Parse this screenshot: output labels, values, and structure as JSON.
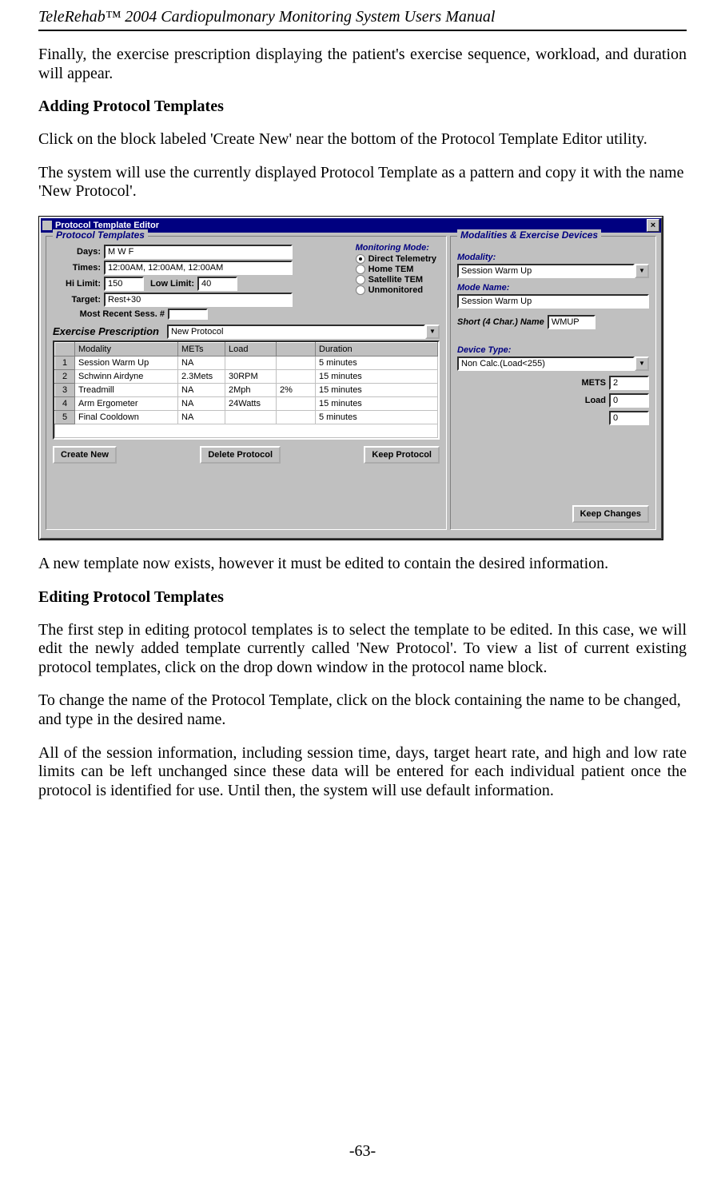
{
  "running_head": "TeleRehab™ 2004 Cardiopulmonary Monitoring System Users Manual",
  "page_number": "-63-",
  "paras": {
    "intro": "Finally, the exercise prescription displaying the patient's exercise sequence, workload, and duration will appear.",
    "add_head": "Adding Protocol Templates",
    "add_p1": "Click on the block labeled 'Create New' near the bottom of the Protocol Template Editor utility.",
    "add_p2": "The system will use the currently displayed Protocol Template as a pattern and copy it with the name 'New Protocol'.",
    "after_dialog": "A new template now exists, however it must be edited to contain the desired information.",
    "edit_head": "Editing Protocol Templates",
    "edit_p1": "The first step in editing protocol templates is to select the template to be edited. In this case, we will edit the newly added template currently called 'New Protocol'. To view a list of current existing protocol templates, click on the drop down window in the protocol name block.",
    "edit_p2": "To change the name of the Protocol Template, click on the block containing the name to be changed, and type in the desired name.",
    "edit_p3": "All of the session information, including session time, days, target heart rate, and high and low rate limits can be left unchanged since these data will be entered for each individual patient once the protocol is identified for use. Until then, the system will use default information."
  },
  "dialog": {
    "title": "Protocol Template Editor",
    "close_glyph": "×",
    "left": {
      "legend": "Protocol Templates",
      "labels": {
        "days": "Days:",
        "times": "Times:",
        "hi_limit": "Hi Limit:",
        "low_limit": "Low Limit:",
        "target": "Target:",
        "recent": "Most Recent Sess. #"
      },
      "values": {
        "days": "M W F",
        "times": "12:00AM, 12:00AM, 12:00AM",
        "hi_limit": "150",
        "low_limit": "40",
        "target": "Rest+30",
        "recent": ""
      },
      "monitoring": {
        "header": "Monitoring Mode:",
        "options": [
          "Direct Telemetry",
          "Home TEM",
          "Satellite TEM",
          "Unmonitored"
        ],
        "selected": 0
      },
      "exercise_section": "Exercise Prescription",
      "protocol_name": "New Protocol",
      "columns": [
        "",
        "Modality",
        "METs",
        "Load",
        "",
        "Duration"
      ],
      "rows": [
        {
          "n": "1",
          "modality": "Session Warm Up",
          "mets": "NA",
          "load": "",
          "extra": "",
          "duration": "5 minutes"
        },
        {
          "n": "2",
          "modality": "Schwinn Airdyne",
          "mets": "2.3Mets",
          "load": "30RPM",
          "extra": "",
          "duration": "15 minutes"
        },
        {
          "n": "3",
          "modality": "Treadmill",
          "mets": "NA",
          "load": "2Mph",
          "extra": "2%",
          "duration": "15 minutes"
        },
        {
          "n": "4",
          "modality": "Arm Ergometer",
          "mets": "NA",
          "load": "24Watts",
          "extra": "",
          "duration": "15 minutes"
        },
        {
          "n": "5",
          "modality": "Final Cooldown",
          "mets": "NA",
          "load": "",
          "extra": "",
          "duration": "5 minutes"
        }
      ],
      "buttons": {
        "create": "Create New",
        "delete": "Delete Protocol",
        "keep": "Keep Protocol"
      }
    },
    "right": {
      "legend": "Modalities & Exercise Devices",
      "labels": {
        "modality": "Modality:",
        "mode_name": "Mode Name:",
        "short_name": "Short (4 Char.) Name",
        "device_type": "Device Type:",
        "mets": "METS",
        "load": "Load"
      },
      "values": {
        "modality": "Session Warm Up",
        "mode_name": "Session Warm Up",
        "short_name": "WMUP",
        "device_type": "Non Calc.(Load<255)",
        "mets": "2",
        "load": "0",
        "extra": "0"
      },
      "button": "Keep Changes"
    }
  }
}
